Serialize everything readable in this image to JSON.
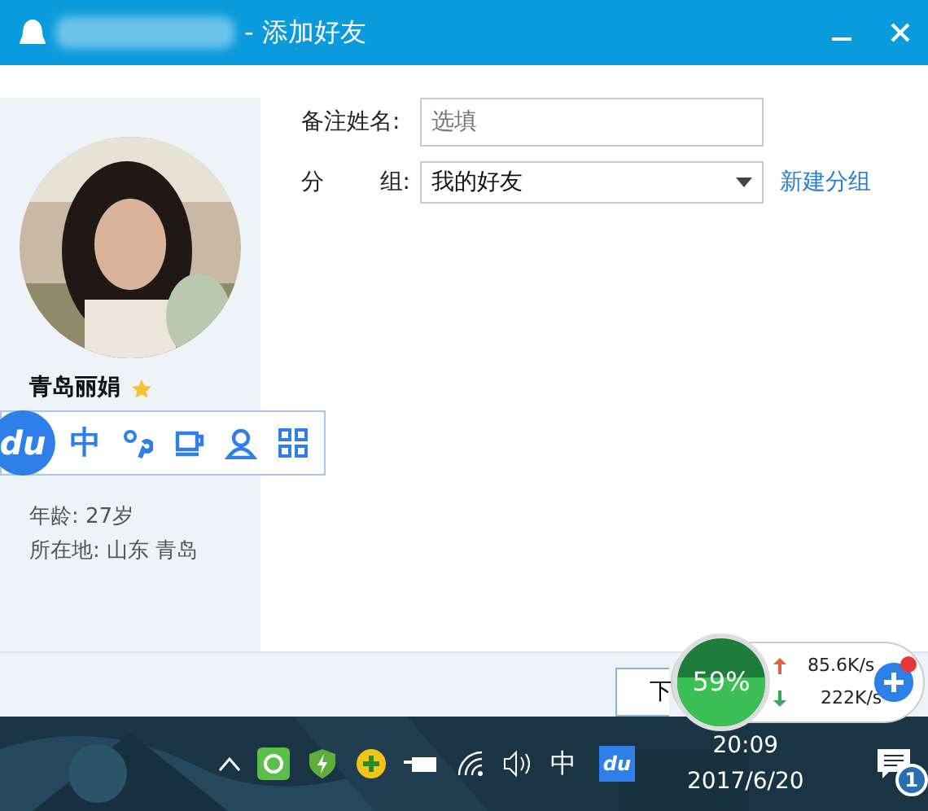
{
  "window": {
    "title": "- 添加好友"
  },
  "profile": {
    "name": "青岛丽娟",
    "starred": true,
    "age": "年龄: 27岁",
    "location": "所在地: 山东  青岛"
  },
  "form": {
    "remark_label": "备注姓名:",
    "remark_placeholder": "选填",
    "group_label_first": "分",
    "group_label_second": "组:",
    "group_value": "我的好友",
    "new_group_link": "新建分组"
  },
  "footer": {
    "button": "下"
  },
  "ime_toolbar": {
    "logo": "du",
    "items": [
      {
        "kind": "text",
        "label": "中"
      },
      {
        "kind": "punctuation"
      },
      {
        "kind": "cup"
      },
      {
        "kind": "person"
      },
      {
        "kind": "grid"
      }
    ]
  },
  "speed_widget": {
    "percent": "59%",
    "upload": "85.6K/s",
    "download": "222K/s",
    "alert": true
  },
  "taskbar": {
    "ime": "中",
    "baidu": "du",
    "time": "20:09",
    "date": "2017/6/20",
    "notifications": "1"
  }
}
